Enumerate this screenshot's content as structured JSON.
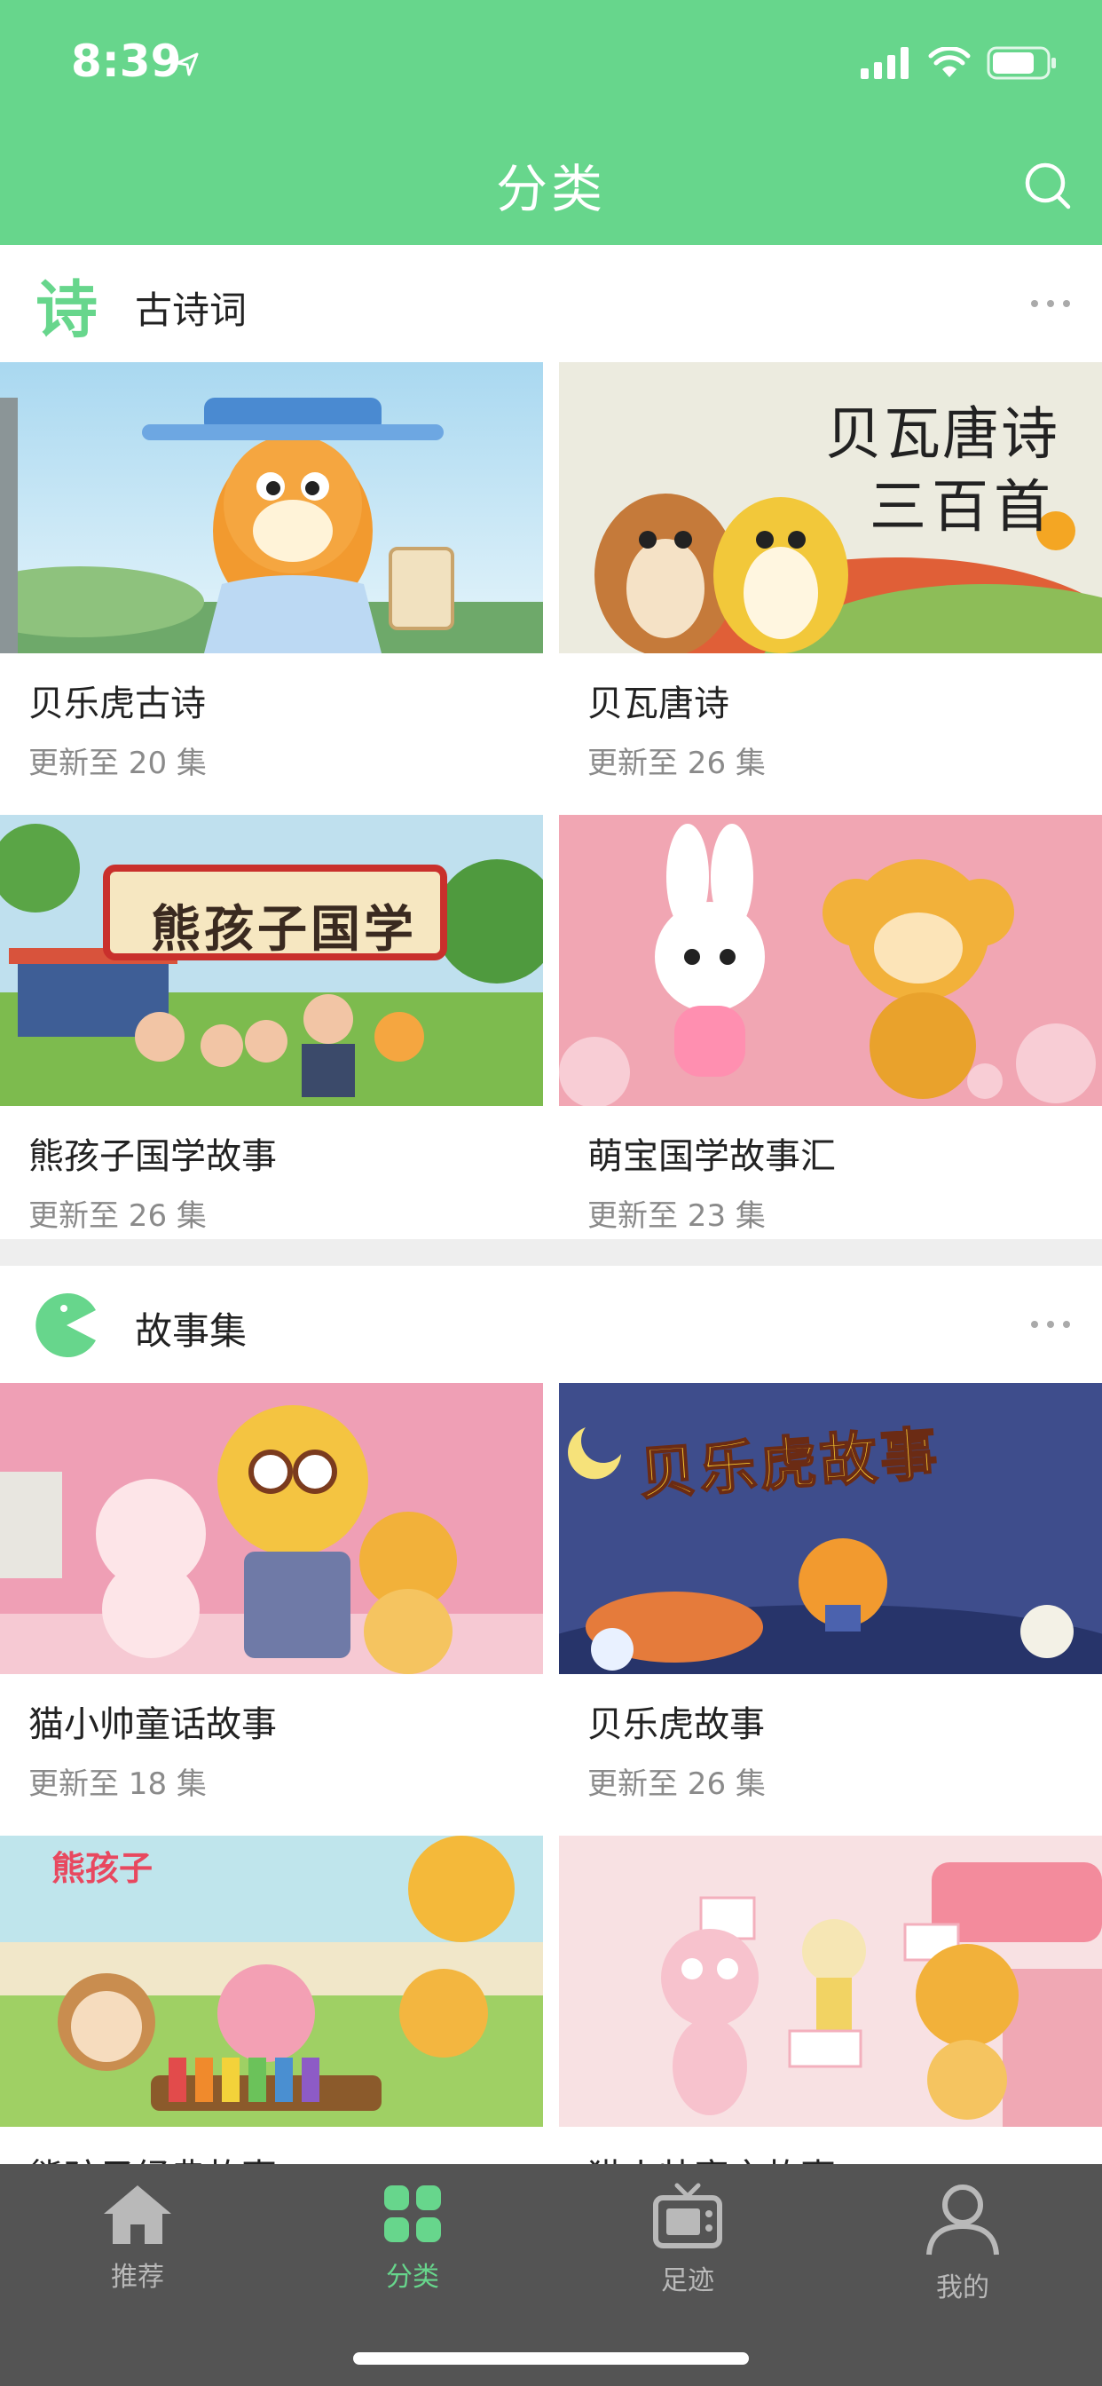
{
  "status": {
    "time": "8:39"
  },
  "header": {
    "title": "分类"
  },
  "sections": [
    {
      "icon_text": "诗",
      "title": "古诗词",
      "items": [
        {
          "name": "贝乐虎古诗",
          "sub": "更新至 20 集"
        },
        {
          "name": "贝瓦唐诗",
          "sub": "更新至 26 集",
          "thumb_text_1": "贝瓦唐诗",
          "thumb_text_2": "三百首"
        },
        {
          "name": "熊孩子国学故事",
          "sub": "更新至 26 集",
          "thumb_text": "熊孩子国学"
        },
        {
          "name": "萌宝国学故事汇",
          "sub": "更新至 23 集"
        }
      ]
    },
    {
      "title": "故事集",
      "items": [
        {
          "name": "猫小帅童话故事",
          "sub": "更新至 18 集"
        },
        {
          "name": "贝乐虎故事",
          "sub": "更新至 26 集",
          "thumb_text": "贝乐虎故事"
        },
        {
          "name": "熊孩子经典故事",
          "sub": "",
          "thumb_text": "熊孩子"
        },
        {
          "name": "猫小帅寓言故事",
          "sub": ""
        }
      ]
    }
  ],
  "tabs": [
    {
      "label": "推荐",
      "icon": "home-icon"
    },
    {
      "label": "分类",
      "icon": "grid-icon"
    },
    {
      "label": "足迹",
      "icon": "tv-icon"
    },
    {
      "label": "我的",
      "icon": "person-icon"
    }
  ],
  "colors": {
    "accent": "#67d68c",
    "tabbar": "#545454"
  }
}
